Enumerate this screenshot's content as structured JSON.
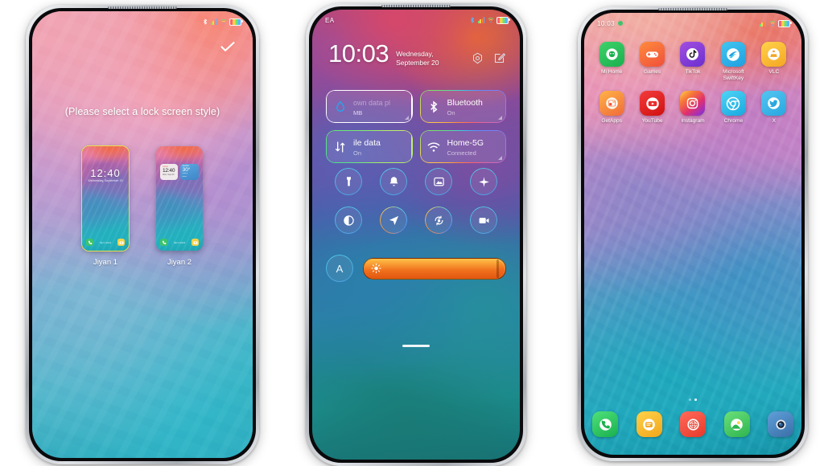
{
  "scene": {
    "background": "#ffffff",
    "phone_count": 3
  },
  "phone1": {
    "name": "lock-screen-style-picker",
    "statusbar": {
      "left": "",
      "icons": [
        "bluetooth-icon",
        "signal-bars-icon",
        "wifi-icon",
        "battery-icon"
      ]
    },
    "confirm_icon": "check-icon",
    "hint": "(Please select a lock screen style)",
    "styles": [
      {
        "label": "Jiyan 1",
        "selected": true,
        "clock": "12:40",
        "sub": "Wednesday, September 20",
        "shortcuts": [
          "phone-icon",
          "camera-icon"
        ],
        "footer": "Tap to unlock"
      },
      {
        "label": "Jiyan 2",
        "selected": false,
        "widget_clock": {
          "label": "Clock",
          "time": "12:40",
          "date": "Wed, Sept 20"
        },
        "widget_weather": {
          "label": "Weather",
          "temp": "30°",
          "line1": "Sunny",
          "line2": "Delhi"
        },
        "shortcuts": [
          "phone-icon",
          "camera-icon"
        ],
        "footer": "Tap to unlock"
      }
    ]
  },
  "phone2": {
    "name": "control-center",
    "statusbar": {
      "carrier": "EA",
      "icons": [
        "bluetooth-icon",
        "signal-bars-icon",
        "wifi-icon",
        "battery-icon"
      ]
    },
    "clock": "10:03",
    "date_line1": "Wednesday,",
    "date_line2": "September 20",
    "header_icons": [
      "settings-gear-icon",
      "edit-icon"
    ],
    "tiles": [
      {
        "title": "own data pl",
        "subtitle": "MB",
        "icon": "data-usage-icon",
        "border": "white",
        "state": ""
      },
      {
        "title": "Bluetooth",
        "subtitle": "On",
        "icon": "bluetooth-icon",
        "border": "rainbow",
        "state": "On"
      },
      {
        "title": "ile data",
        "subtitle": "On",
        "icon": "mobile-data-icon",
        "border": "green",
        "state": "On"
      },
      {
        "title": "Home-5G",
        "subtitle": "Connected",
        "icon": "wifi-icon",
        "border": "rainbow",
        "state": "Connected"
      }
    ],
    "toggles": [
      {
        "name": "flashlight-icon"
      },
      {
        "name": "notification-bell-icon"
      },
      {
        "name": "screenshot-icon"
      },
      {
        "name": "airplane-mode-icon"
      },
      {
        "name": "dark-mode-icon"
      },
      {
        "name": "location-icon"
      },
      {
        "name": "rotation-lock-icon"
      },
      {
        "name": "screen-record-icon"
      }
    ],
    "brightness": {
      "auto_label": "A",
      "value_percent": 94,
      "icon": "brightness-sun-icon"
    }
  },
  "phone3": {
    "name": "home-screen",
    "statusbar": {
      "time": "10:03",
      "icons": [
        "signal-bars-icon",
        "wifi-icon",
        "battery-icon"
      ]
    },
    "apps": [
      {
        "label": "Mi Home",
        "icon": "mi-home-icon"
      },
      {
        "label": "Games",
        "icon": "games-icon"
      },
      {
        "label": "TikTok",
        "icon": "tiktok-icon"
      },
      {
        "label": "Microsoft SwiftKey",
        "icon": "swiftkey-icon"
      },
      {
        "label": "VLC",
        "icon": "vlc-icon"
      },
      {
        "label": "GetApps",
        "icon": "getapps-icon"
      },
      {
        "label": "YouTube",
        "icon": "youtube-icon"
      },
      {
        "label": "Instagram",
        "icon": "instagram-icon"
      },
      {
        "label": "Chrome",
        "icon": "chrome-icon"
      },
      {
        "label": "X",
        "icon": "twitter-icon"
      }
    ],
    "page_dots": {
      "count": 2,
      "active_index": 1
    },
    "dock": [
      {
        "label": "Phone",
        "icon": "phone-icon"
      },
      {
        "label": "Messages",
        "icon": "messages-icon"
      },
      {
        "label": "Security",
        "icon": "security-icon"
      },
      {
        "label": "Gallery",
        "icon": "gallery-icon"
      },
      {
        "label": "Camera",
        "icon": "camera-icon"
      }
    ]
  }
}
